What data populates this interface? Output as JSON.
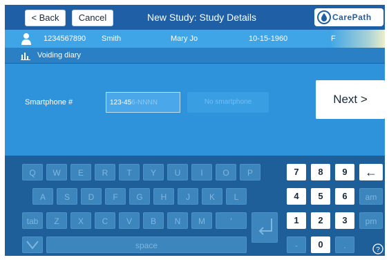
{
  "topbar": {
    "back_label": "< Back",
    "cancel_label": "Cancel",
    "title": "New Study: Study Details",
    "logo_text": "CarePath"
  },
  "patient": {
    "id": "1234567890",
    "last_name": "Smith",
    "first_name": "Mary Jo",
    "dob": "10-15-1960",
    "sex": "F"
  },
  "study": {
    "type": "Voiding diary"
  },
  "form": {
    "phone_label": "Smartphone #",
    "phone_value": "123-45",
    "phone_placeholder_rest": "6-NNNN",
    "no_smartphone_label": "No smartphone",
    "next_label": "Next >"
  },
  "keyboard": {
    "row1": [
      "Q",
      "W",
      "E",
      "R",
      "T",
      "Y",
      "U",
      "I",
      "O",
      "P"
    ],
    "row2": [
      "A",
      "S",
      "D",
      "F",
      "G",
      "H",
      "J",
      "K",
      "L"
    ],
    "row3": [
      "tab",
      "Z",
      "X",
      "C",
      "V",
      "B",
      "N",
      "M",
      "'"
    ],
    "space_label": "space",
    "numpad_row1": [
      "7",
      "8",
      "9"
    ],
    "numpad_row2": [
      "4",
      "5",
      "6"
    ],
    "numpad_row3": [
      "1",
      "2",
      "3"
    ],
    "numpad_row4": [
      "-",
      "0",
      "."
    ],
    "backspace_glyph": "←",
    "am_label": "am",
    "pm_label": "pm",
    "help_icon": "help-icon",
    "colors": {
      "active_key": "#ffffff",
      "inactive_key": "#3d86bd",
      "background": "#1e5f9a"
    }
  },
  "colors": {
    "topbar": "#1f5fa6",
    "patient_row": "#3fa5e6",
    "form_bg": "#2f93dc"
  }
}
